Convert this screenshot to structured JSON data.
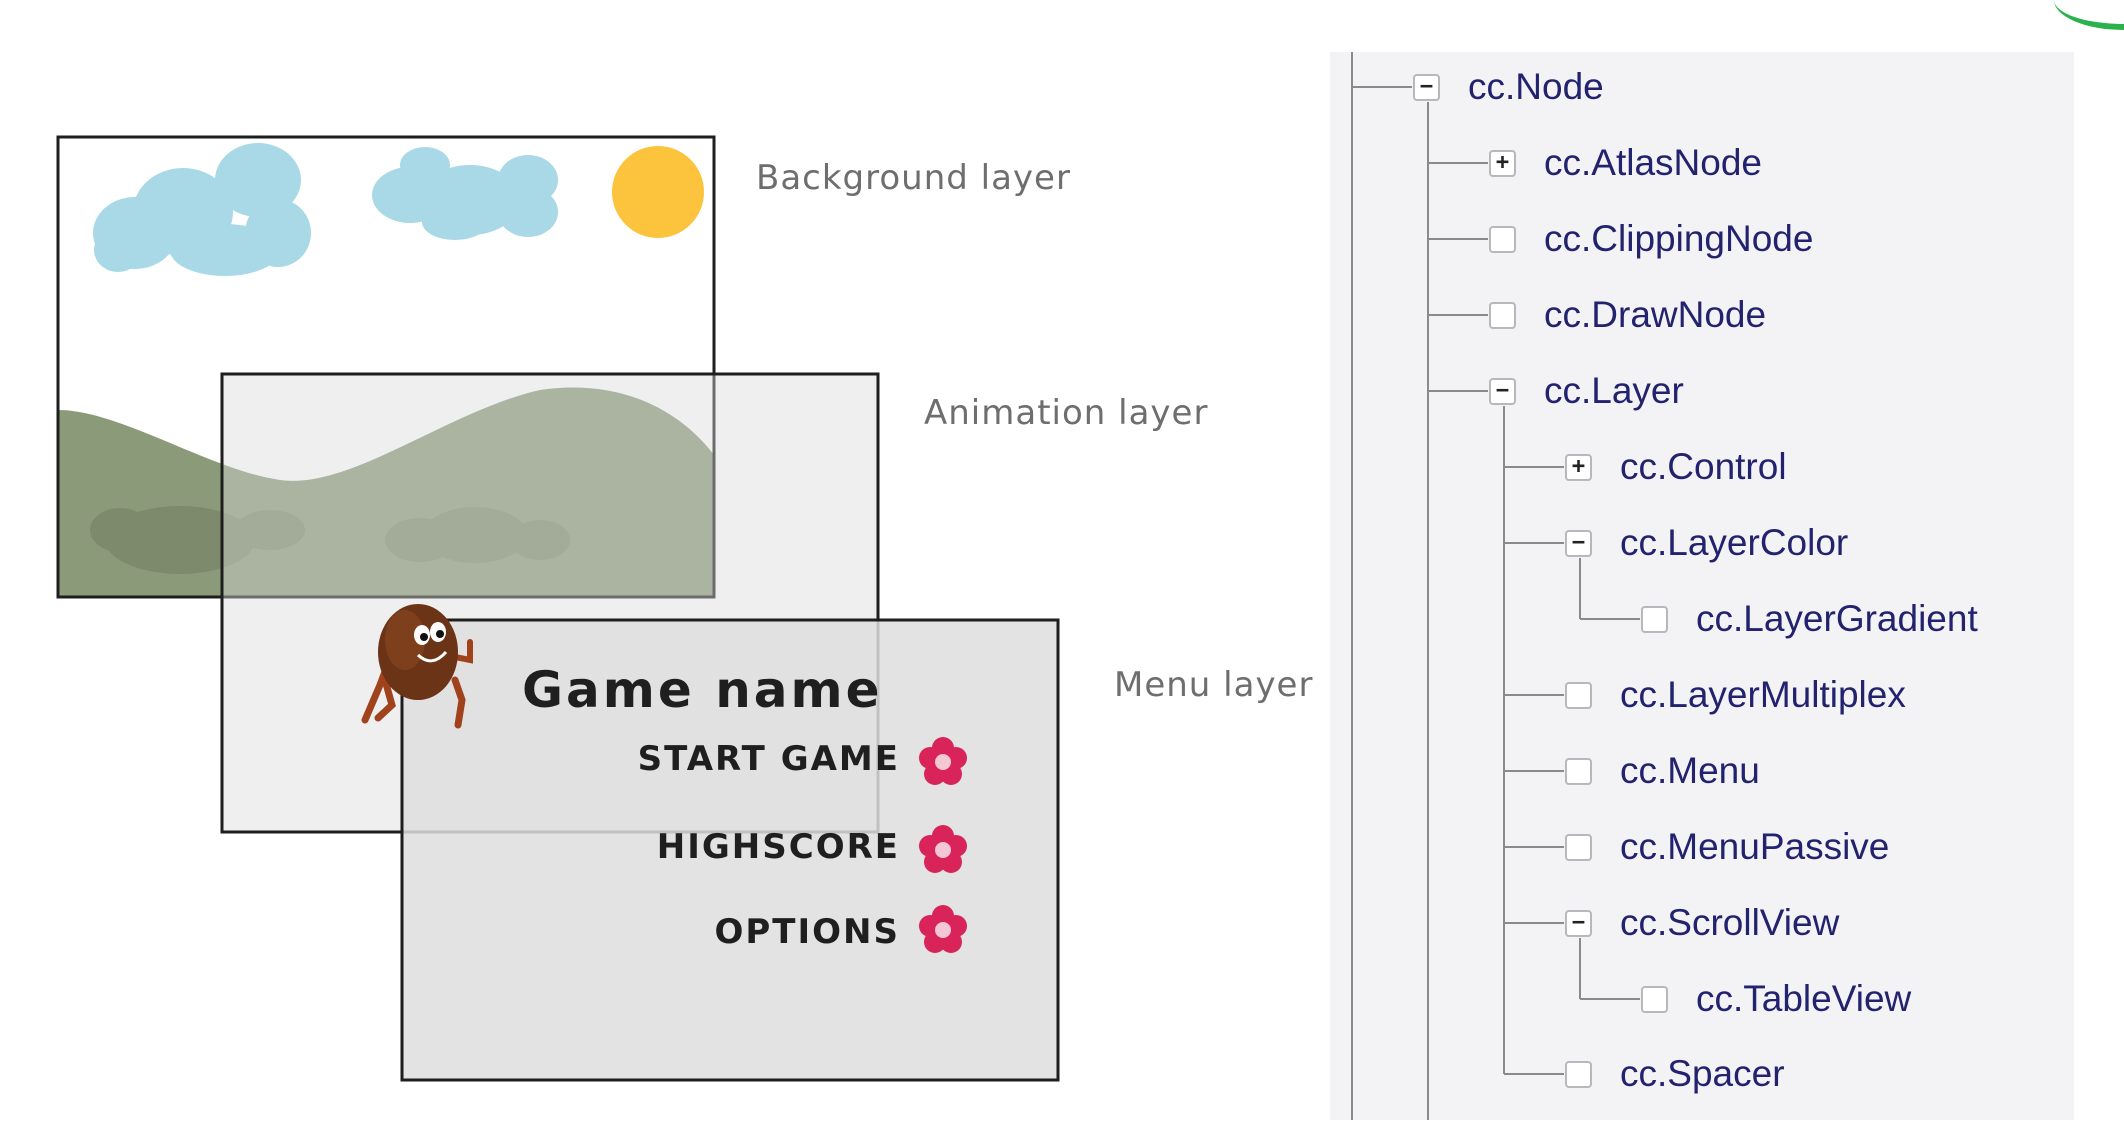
{
  "diagram": {
    "labels": {
      "background": "Background layer",
      "animation": "Animation layer",
      "menu": "Menu layer"
    },
    "menu": {
      "title": "Game name",
      "items": [
        "START GAME",
        "HIGHSCORE",
        "OPTIONS"
      ]
    },
    "colors": {
      "sky_cloud": "#a9d8e6",
      "sun": "#fcc33c",
      "hill": "#8b9a78",
      "layer_fill": "#e3e3e3",
      "flower": "#d9245a",
      "character": "#6b3416"
    }
  },
  "tree": {
    "colors": {
      "label": "#22226e",
      "line": "#8a8a8a",
      "panel": "#f3f3f5"
    },
    "nodes": [
      {
        "label": "cc.Node",
        "state": "expanded",
        "level": 0
      },
      {
        "label": "cc.AtlasNode",
        "state": "collapsed",
        "level": 1
      },
      {
        "label": "cc.ClippingNode",
        "state": "leaf",
        "level": 1
      },
      {
        "label": "cc.DrawNode",
        "state": "leaf",
        "level": 1
      },
      {
        "label": "cc.Layer",
        "state": "expanded",
        "level": 1
      },
      {
        "label": "cc.Control",
        "state": "collapsed",
        "level": 2
      },
      {
        "label": "cc.LayerColor",
        "state": "expanded",
        "level": 2
      },
      {
        "label": "cc.LayerGradient",
        "state": "leaf",
        "level": 3
      },
      {
        "label": "cc.LayerMultiplex",
        "state": "leaf",
        "level": 2
      },
      {
        "label": "cc.Menu",
        "state": "leaf",
        "level": 2
      },
      {
        "label": "cc.MenuPassive",
        "state": "leaf",
        "level": 2
      },
      {
        "label": "cc.ScrollView",
        "state": "expanded",
        "level": 2
      },
      {
        "label": "cc.TableView",
        "state": "leaf",
        "level": 3
      },
      {
        "label": "cc.Spacer",
        "state": "leaf",
        "level": 2
      }
    ]
  }
}
